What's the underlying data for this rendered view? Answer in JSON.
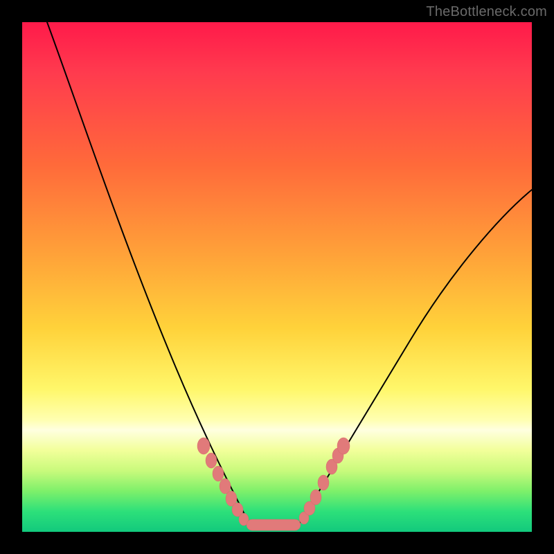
{
  "watermark": "TheBottleneck.com",
  "chart_data": {
    "type": "line",
    "title": "",
    "xlabel": "",
    "ylabel": "",
    "xlim": [
      0,
      100
    ],
    "ylim": [
      0,
      100
    ],
    "grid": false,
    "legend": false,
    "series": [
      {
        "name": "left-curve",
        "x": [
          5,
          10,
          15,
          20,
          25,
          30,
          33,
          36,
          39,
          41,
          43,
          45
        ],
        "values": [
          100,
          88,
          72,
          55,
          40,
          27,
          20,
          14,
          9,
          5,
          2,
          0
        ]
      },
      {
        "name": "right-curve",
        "x": [
          53,
          56,
          60,
          65,
          70,
          76,
          83,
          90,
          97,
          100
        ],
        "values": [
          0,
          3,
          8,
          15,
          23,
          32,
          42,
          52,
          62,
          66
        ]
      }
    ],
    "marker_points": {
      "left": [
        {
          "x": 35.5,
          "y": 16
        },
        {
          "x": 36.8,
          "y": 13
        },
        {
          "x": 38.0,
          "y": 10.5
        },
        {
          "x": 39.2,
          "y": 8
        },
        {
          "x": 40.3,
          "y": 5.8
        },
        {
          "x": 41.3,
          "y": 4.0
        },
        {
          "x": 42.5,
          "y": 2.0
        }
      ],
      "right": [
        {
          "x": 55.0,
          "y": 2.0
        },
        {
          "x": 56.0,
          "y": 3.5
        },
        {
          "x": 57.0,
          "y": 5.2
        },
        {
          "x": 58.5,
          "y": 8.0
        },
        {
          "x": 60.0,
          "y": 11.0
        },
        {
          "x": 61.0,
          "y": 13.0
        },
        {
          "x": 62.0,
          "y": 15.0
        }
      ]
    },
    "bottom_bar": {
      "x_start": 44,
      "x_end": 54,
      "y": 0.6,
      "thickness": 2.4
    }
  },
  "colors": {
    "bead": "#e17a7a",
    "curve": "#000000"
  }
}
